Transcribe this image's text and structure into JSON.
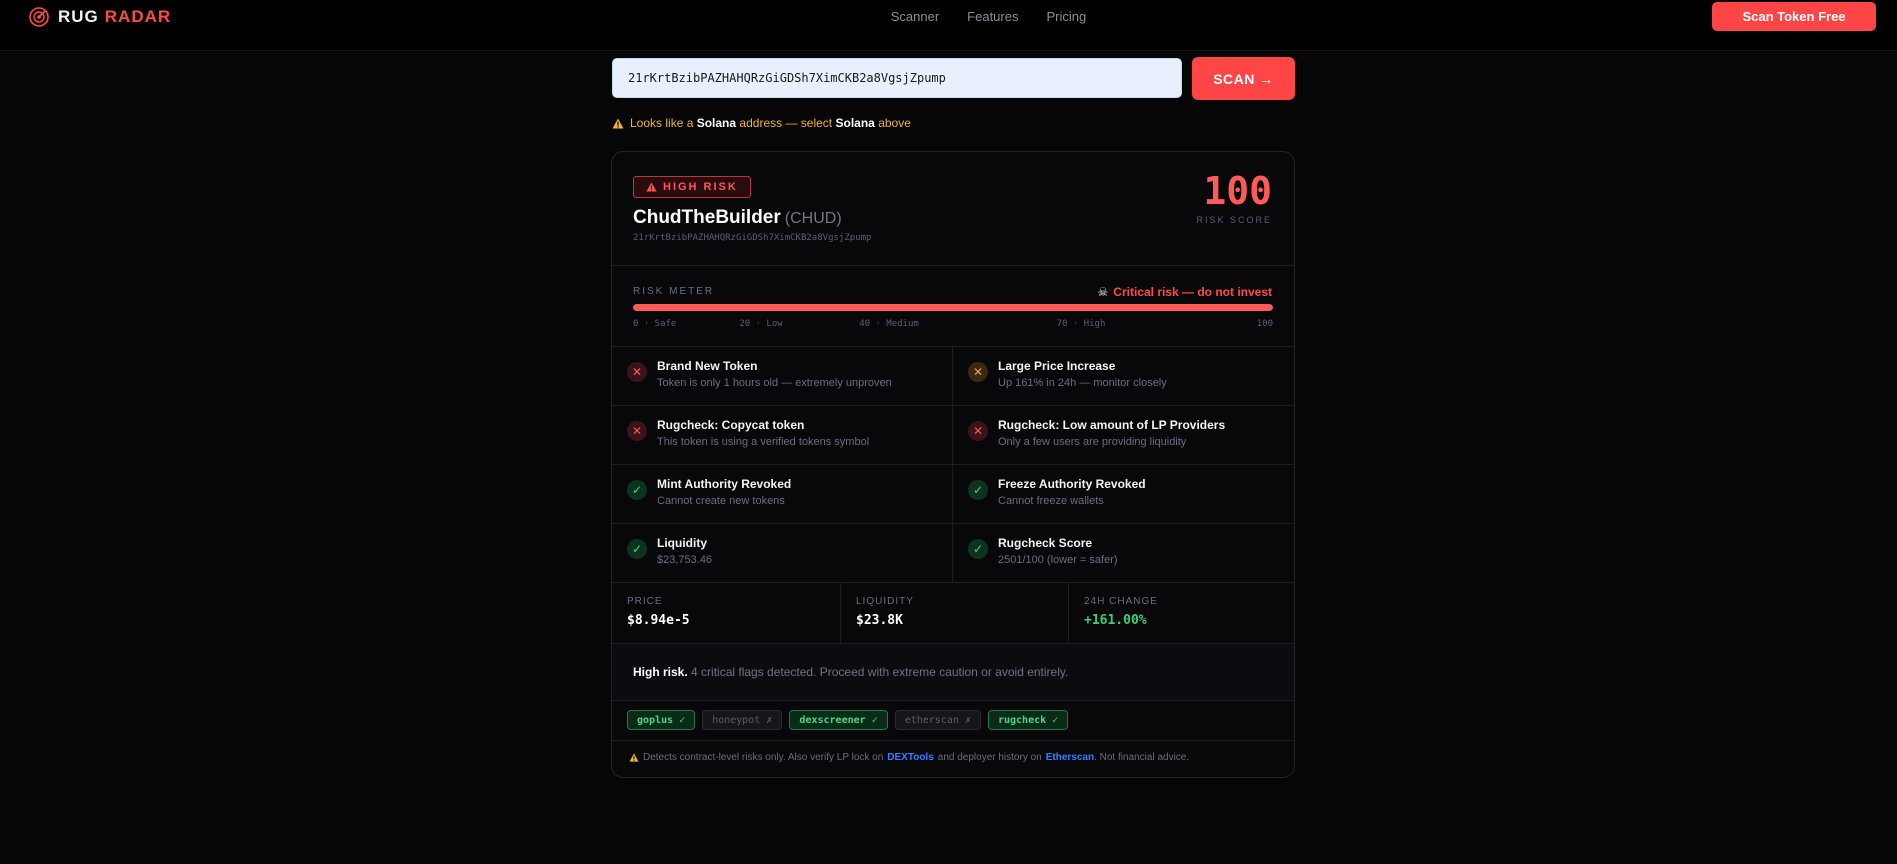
{
  "colors": {
    "accent": "#ff4545",
    "pass": "#36d77a",
    "warn": "#f0a040",
    "link": "#3a7dff"
  },
  "nav": {
    "brand_part1": "RUG",
    "brand_part2": "RADAR",
    "links": [
      "Scanner",
      "Features",
      "Pricing"
    ],
    "cta": "Scan Token Free"
  },
  "scan": {
    "address_value": "21rKrtBzibPAZHAHQRzGiGDSh7XimCKB2a8VgsjZpump",
    "button": "SCAN →"
  },
  "hint": {
    "p1": "Looks like a",
    "chain": "Solana",
    "p2": "address — select",
    "chain2": "Solana",
    "p3": "above"
  },
  "result": {
    "badge": "HIGH RISK",
    "token_name": "ChudTheBuilder",
    "token_symbol": "(CHUD)",
    "token_address": "21rKrtBzibPAZHAHQRzGiGDSh7XimCKB2a8VgsjZpump",
    "score": "100",
    "score_label": "RISK SCORE"
  },
  "meter": {
    "label": "RISK METER",
    "status": "Critical risk — do not invest",
    "level_percent": 100,
    "ticks": [
      {
        "text": "0 · Safe",
        "pos": 0
      },
      {
        "text": "20 · Low",
        "pos": 20
      },
      {
        "text": "40 · Medium",
        "pos": 40
      },
      {
        "text": "70 · High",
        "pos": 70
      },
      {
        "text": "100",
        "pos": 100
      }
    ]
  },
  "checks": [
    {
      "status": "fail",
      "title": "Brand New Token",
      "desc": "Token is only 1 hours old — extremely unproven"
    },
    {
      "status": "warn",
      "title": "Large Price Increase",
      "desc": "Up 161% in 24h — monitor closely"
    },
    {
      "status": "fail",
      "title": "Rugcheck: Copycat token",
      "desc": "This token is using a verified tokens symbol"
    },
    {
      "status": "fail",
      "title": "Rugcheck: Low amount of LP Providers",
      "desc": "Only a few users are providing liquidity"
    },
    {
      "status": "pass",
      "title": "Mint Authority Revoked",
      "desc": "Cannot create new tokens"
    },
    {
      "status": "pass",
      "title": "Freeze Authority Revoked",
      "desc": "Cannot freeze wallets"
    },
    {
      "status": "pass",
      "title": "Liquidity",
      "desc": "$23,753.46"
    },
    {
      "status": "pass",
      "title": "Rugcheck Score",
      "desc": "2501/100 (lower = safer)"
    }
  ],
  "stats": [
    {
      "label": "PRICE",
      "value": "$8.94e-5",
      "trend": "neutral"
    },
    {
      "label": "LIQUIDITY",
      "value": "$23.8K",
      "trend": "neutral"
    },
    {
      "label": "24H CHANGE",
      "value": "+161.00%",
      "trend": "up"
    }
  ],
  "summary": {
    "bold": "High risk.",
    "text": "4 critical flags detected. Proceed with extreme caution or avoid entirely."
  },
  "sources": [
    {
      "name": "goplus",
      "status": "ok",
      "mark": "✓"
    },
    {
      "name": "honeypot",
      "status": "off",
      "mark": "✗"
    },
    {
      "name": "dexscreener",
      "status": "ok",
      "mark": "✓"
    },
    {
      "name": "etherscan",
      "status": "off",
      "mark": "✗"
    },
    {
      "name": "rugcheck",
      "status": "ok",
      "mark": "✓"
    }
  ],
  "disclaimer": {
    "p1": "Detects contract-level risks only. Also verify LP lock on",
    "link1": "DEXTools",
    "p2": "and deployer history on",
    "link2": "Etherscan",
    "p3": ". Not financial advice."
  }
}
